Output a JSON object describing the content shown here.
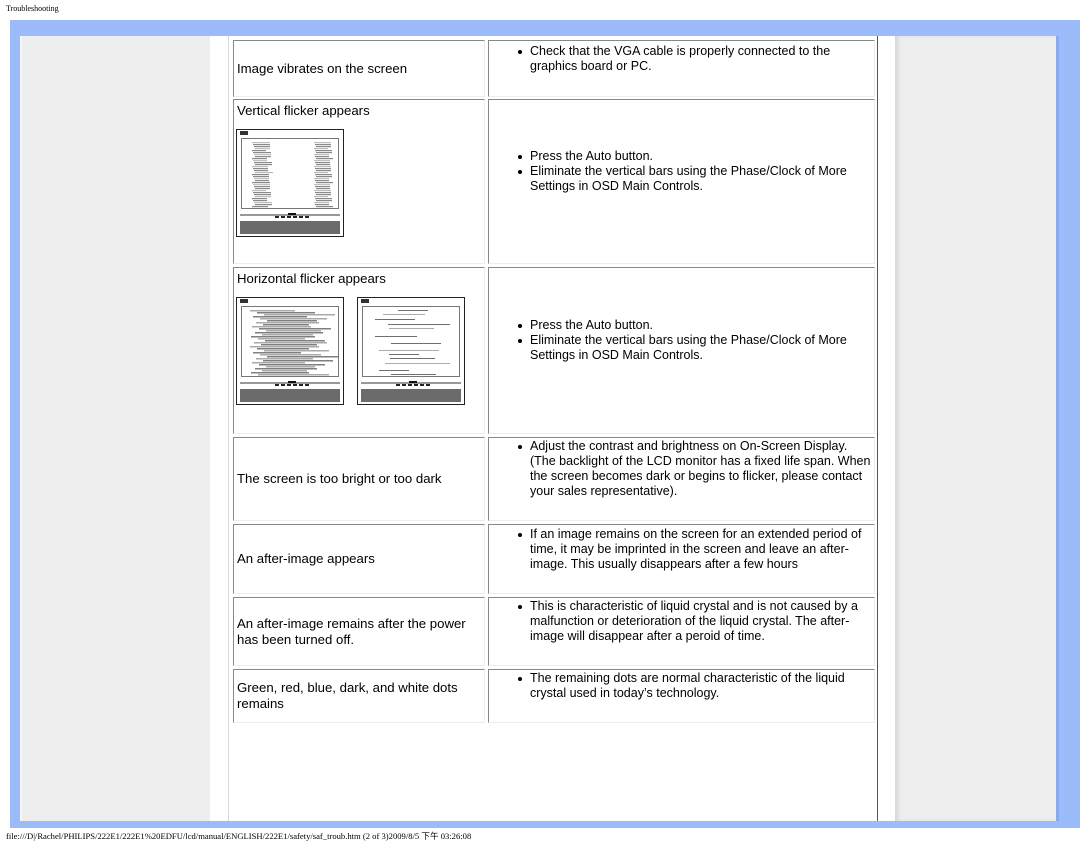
{
  "page": {
    "header": "Troubleshooting",
    "footer": "file:///D|/Rachel/PHILIPS/222E1/222E1%20EDFU/lcd/manual/ENGLISH/222E1/safety/saf_troub.htm (2 of 3)2009/8/5 下午 03:26:08"
  },
  "colors": {
    "frame_blue": "#9bbcf8",
    "panel_grey": "#eeeeee"
  },
  "rows": [
    {
      "problem": "Image vibrates on the screen",
      "solutions": [
        "Check that the VGA cable is properly connected to the graphics board or PC."
      ]
    },
    {
      "problem": "Vertical flicker appears",
      "image": "vertical-flicker-illustration",
      "solutions": [
        "Press the Auto button.",
        "Eliminate the vertical bars using the Phase/Clock of More Settings in OSD Main Controls."
      ]
    },
    {
      "problem": "Horizontal flicker appears",
      "image": "horizontal-flicker-illustration",
      "solutions": [
        "Press the Auto button.",
        "Eliminate the vertical bars using the Phase/Clock of More Settings in OSD Main Controls."
      ]
    },
    {
      "problem": "The screen is too bright or too dark",
      "solutions": [
        "Adjust the contrast and brightness on On-Screen Display. (The backlight of the LCD monitor has a fixed life span. When the screen becomes dark or begins to flicker, please contact your sales representative)."
      ]
    },
    {
      "problem": "An after-image appears",
      "solutions": [
        "If an image remains on the screen for an extended period of time, it may be imprinted in the screen and leave an after-image. This usually disappears after a few hours"
      ]
    },
    {
      "problem": "An after-image remains after the power has been turned off.",
      "solutions": [
        "This is characteristic of liquid crystal and is not caused by a malfunction or deterioration of the liquid crystal. The after-image will disappear after a peroid of time."
      ]
    },
    {
      "problem": "Green, red, blue, dark, and white dots remains",
      "solutions": [
        "The remaining dots are normal characteristic of the liquid crystal used in today’s technology."
      ]
    }
  ]
}
